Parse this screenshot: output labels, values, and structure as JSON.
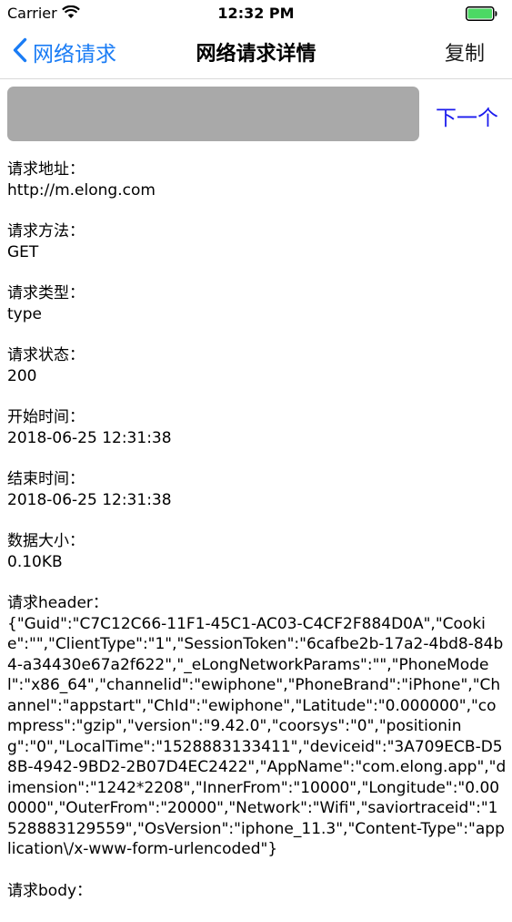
{
  "status_bar": {
    "carrier": "Carrier",
    "time": "12:32 PM"
  },
  "nav": {
    "back_label": "网络请求",
    "title": "网络请求详情",
    "copy_label": "复制"
  },
  "search": {
    "value": "",
    "next_label": "下一个"
  },
  "sections": [
    {
      "label": "请求地址：",
      "value": "http://m.elong.com"
    },
    {
      "label": "请求方法：",
      "value": "GET"
    },
    {
      "label": "请求类型：",
      "value": "type"
    },
    {
      "label": "请求状态：",
      "value": "200"
    },
    {
      "label": "开始时间：",
      "value": "2018-06-25 12:31:38"
    },
    {
      "label": "结束时间：",
      "value": "2018-06-25 12:31:38"
    },
    {
      "label": "数据大小：",
      "value": "0.10KB"
    },
    {
      "label": "请求header：",
      "value": "{\"Guid\":\"C7C12C66-11F1-45C1-AC03-C4CF2F884D0A\",\"Cookie\":\"\",\"ClientType\":\"1\",\"SessionToken\":\"6cafbe2b-17a2-4bd8-84b4-a34430e67a2f622\",\"_eLongNetworkParams\":\"\",\"PhoneModel\":\"x86_64\",\"channelid\":\"ewiphone\",\"PhoneBrand\":\"iPhone\",\"Channel\":\"appstart\",\"ChId\":\"ewiphone\",\"Latitude\":\"0.000000\",\"compress\":\"gzip\",\"version\":\"9.42.0\",\"coorsys\":\"0\",\"positioning\":\"0\",\"LocalTime\":\"1528883133411\",\"deviceid\":\"3A709ECB-D58B-4942-9BD2-2B07D4EC2422\",\"AppName\":\"com.elong.app\",\"dimension\":\"1242*2208\",\"InnerFrom\":\"10000\",\"Longitude\":\"0.000000\",\"OuterFrom\":\"20000\",\"Network\":\"Wifi\",\"saviortraceid\":\"1528883129559\",\"OsVersion\":\"iphone_11.3\",\"Content-Type\":\"application\\/x-www-form-urlencoded\"}"
    },
    {
      "label": "请求body：",
      "value": ""
    }
  ],
  "colors": {
    "accent": "#1a7cf5",
    "next": "#1a1aee",
    "search_field": "#a9a9a9",
    "battery": "#4cd964"
  },
  "icons": [
    "wifi-icon",
    "battery-icon",
    "chevron-left-icon"
  ]
}
